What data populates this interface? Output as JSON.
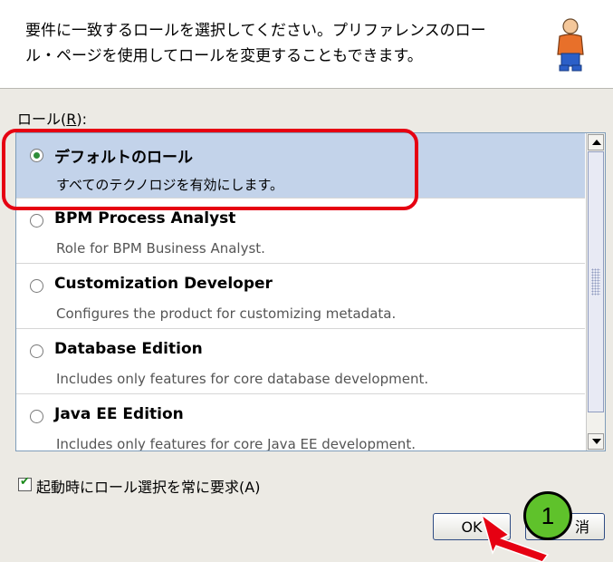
{
  "header": {
    "text_line1": "要件に一致するロールを選択してください。プリファレンスのロー",
    "text_line2": "ル・ページを使用してロールを変更することもできます。"
  },
  "roles_label": {
    "text": "ロール(",
    "mnemonic": "R",
    "suffix": "):"
  },
  "roles": [
    {
      "name": "デフォルトのロール",
      "description": "すべてのテクノロジを有効にします。",
      "selected": true
    },
    {
      "name": "BPM Process Analyst",
      "description": "Role for BPM Business Analyst.",
      "selected": false
    },
    {
      "name": "Customization Developer",
      "description": "Configures the product for customizing metadata.",
      "selected": false
    },
    {
      "name": "Database Edition",
      "description": "Includes only features for core database development.",
      "selected": false
    },
    {
      "name": "Java EE Edition",
      "description": "Includes only features for core Java EE development.",
      "selected": false
    }
  ],
  "checkbox": {
    "label": "起動時にロール選択を常に要求(A)",
    "checked": true
  },
  "buttons": {
    "ok": "OK",
    "cancel": "消"
  },
  "annotation": {
    "step_number": "1"
  },
  "colors": {
    "highlight": "#e60012",
    "badge": "#5fc22b",
    "selection": "#c3d3ea"
  }
}
